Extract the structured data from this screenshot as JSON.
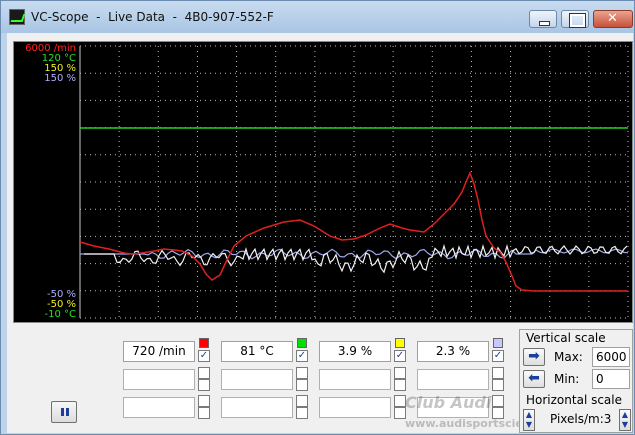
{
  "window": {
    "title": "VC-Scope  -  Live Data  -  4B0-907-552-F"
  },
  "scope": {
    "top_labels": [
      {
        "text": "6000 /min",
        "color": "#ff2020"
      },
      {
        "text": "120 °C",
        "color": "#20e020"
      },
      {
        "text": "150 %",
        "color": "#f0f020"
      },
      {
        "text": "150 %",
        "color": "#b0b0ff"
      }
    ],
    "bottom_labels": [
      {
        "text": "-50 %",
        "color": "#b0b0ff"
      },
      {
        "text": "-50 %",
        "color": "#f0f020"
      },
      {
        "text": "-10 °C",
        "color": "#20e020"
      }
    ],
    "grid": true
  },
  "channels": [
    {
      "value": "720 /min",
      "color": "#ff0000",
      "checked": true
    },
    {
      "value": "81 °C",
      "color": "#00e000",
      "checked": true
    },
    {
      "value": "3.9 %",
      "color": "#ffff00",
      "checked": true
    },
    {
      "value": "2.3 %",
      "color": "#c8c8ff",
      "checked": true
    }
  ],
  "vertical_scale": {
    "title": "Vertical scale",
    "max_label": "Max:",
    "max_value": "6000",
    "min_label": "Min:",
    "min_value": "0"
  },
  "horizontal_scale": {
    "title": "Horizontal scale",
    "value": "Pixels/m:3"
  },
  "watermark": {
    "line1": "Club Audi",
    "line2": "www.audisportscience.com"
  },
  "icons": {
    "pause": "pause-icon",
    "increase": "arrow-right-icon",
    "decrease": "arrow-left-icon"
  }
}
